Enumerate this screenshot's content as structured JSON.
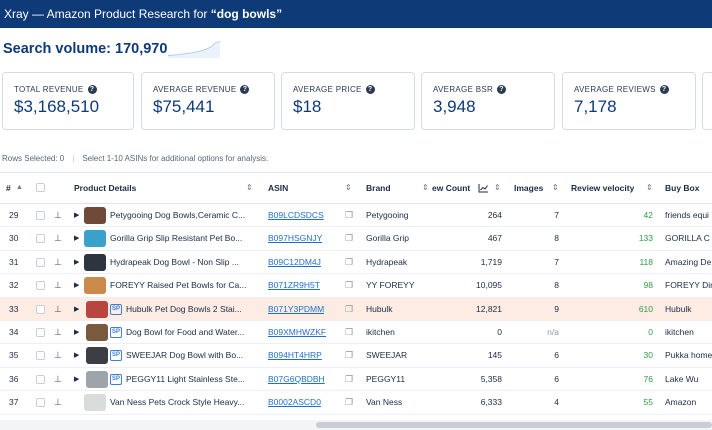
{
  "window": {
    "title_prefix": "Xray — Amazon Product Research for ",
    "title_query": "“dog bowls”"
  },
  "search_volume": {
    "label": "Search volume: 170,970"
  },
  "cards": [
    {
      "label": "TOTAL REVENUE",
      "value": "$3,168,510"
    },
    {
      "label": "AVERAGE REVENUE",
      "value": "$75,441"
    },
    {
      "label": "AVERAGE PRICE",
      "value": "$18"
    },
    {
      "label": "AVERAGE BSR",
      "value": "3,948"
    },
    {
      "label": "AVERAGE REVIEWS",
      "value": "7,178"
    }
  ],
  "selection": {
    "rows_selected": "Rows Selected: 0",
    "hint": "Select 1-10 ASINs for additional options for analysis."
  },
  "columns": {
    "index": "#",
    "product": "Product Details",
    "asin": "ASIN",
    "brand": "Brand",
    "review_count": "ew Count",
    "images": "Images",
    "velocity": "Review velocity",
    "buybox": "Buy Box"
  },
  "rows": [
    {
      "n": "29",
      "sp": "",
      "title": "Petygooing Dog Bowls,Ceramic C...",
      "asin": "B09LCDSDCS",
      "brand": "Petygooing",
      "reviews": "264",
      "images": "7",
      "velocity": "42",
      "buybox": "friends equi",
      "thumb_color": "#6f4a3a"
    },
    {
      "n": "30",
      "sp": "",
      "title": "Gorilla Grip Slip Resistant Pet Bo...",
      "asin": "B097HSGNJY",
      "brand": "Gorilla Grip",
      "reviews": "467",
      "images": "8",
      "velocity": "133",
      "buybox": "GORILLA C",
      "thumb_color": "#3aa1c9"
    },
    {
      "n": "31",
      "sp": "",
      "title": "Hydrapeak Dog Bowl - Non Slip ...",
      "asin": "B09C12DM4J",
      "brand": "Hydrapeak",
      "reviews": "1,719",
      "images": "7",
      "velocity": "118",
      "buybox": "Amazing De",
      "thumb_color": "#2d3540"
    },
    {
      "n": "32",
      "sp": "",
      "title": "FOREYY Raised Pet Bowls for Ca...",
      "asin": "B071ZR9H5T",
      "brand": "YY FOREYY",
      "reviews": "10,095",
      "images": "8",
      "velocity": "98",
      "buybox": "FOREYY Dir",
      "thumb_color": "#c98a4b"
    },
    {
      "n": "33",
      "sp": "SP",
      "title": "Hubulk Pet Dog Bowls 2 Stai...",
      "asin": "B071Y3PDMM",
      "brand": "Hubulk",
      "reviews": "12,821",
      "images": "9",
      "velocity": "610",
      "buybox": "Hubulk",
      "thumb_color": "#b8463f",
      "highlight": true
    },
    {
      "n": "34",
      "sp": "SP",
      "title": "Dog Bowl for Food and Water...",
      "asin": "B09XMHWZKF",
      "brand": "ikitchen",
      "reviews": "0",
      "images": "n/a",
      "velocity": "0",
      "buybox": "ikitchen",
      "thumb_color": "#7a5a3f"
    },
    {
      "n": "35",
      "sp": "SP",
      "title": "SWEEJAR Dog Bowl with Bo...",
      "asin": "B094HT4HRP",
      "brand": "SWEEJAR",
      "reviews": "145",
      "images": "6",
      "velocity": "30",
      "buybox": "Pukka home",
      "thumb_color": "#3b3f45"
    },
    {
      "n": "36",
      "sp": "SP",
      "title": "PEGGY11 Light Stainless Ste...",
      "asin": "B07G6QBDBH",
      "brand": "PEGGY11",
      "reviews": "5,358",
      "images": "6",
      "velocity": "76",
      "buybox": "Lake Wu",
      "thumb_color": "#9ea4ab"
    },
    {
      "n": "37",
      "sp": "",
      "title": "Van Ness Pets Crock Style Heavy...",
      "asin": "B0002ASCD0",
      "brand": "Van Ness",
      "reviews": "6,333",
      "images": "4",
      "velocity": "55",
      "buybox": "Amazon",
      "thumb_color": "#d9dcd8"
    }
  ],
  "colors": {
    "header": "#0e3a78",
    "link": "#1f6fd0",
    "velocity": "#2f9e44",
    "highlight_row": "#fdece4"
  },
  "icons": [
    "help-circle-icon",
    "sort-icon",
    "pin-icon",
    "expand-caret-icon",
    "copy-icon",
    "chart-icon"
  ]
}
